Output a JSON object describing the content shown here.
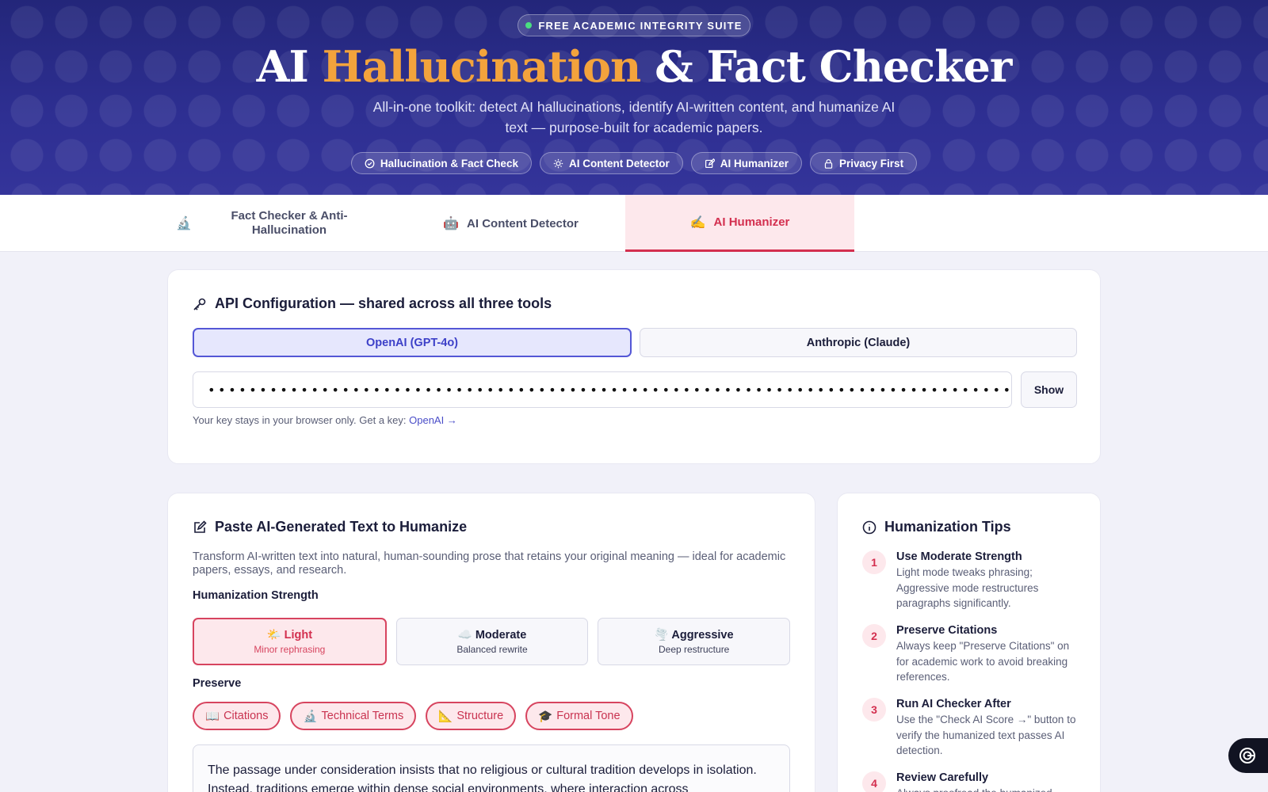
{
  "hero": {
    "badge": "FREE ACADEMIC INTEGRITY SUITE",
    "title_part1": "AI ",
    "title_accent": "Hallucination",
    "title_part2": " & Fact Checker",
    "subtitle": "All-in-one toolkit: detect AI hallucinations, identify AI-written content, and humanize AI text — purpose-built for academic papers.",
    "pills": [
      {
        "label": "Hallucination & Fact Check",
        "icon": "check-circle-icon"
      },
      {
        "label": "AI Content Detector",
        "icon": "bulb-icon"
      },
      {
        "label": "AI Humanizer",
        "icon": "edit-icon"
      },
      {
        "label": "Privacy First",
        "icon": "lock-icon"
      }
    ]
  },
  "tabs": [
    {
      "label": "Fact Checker & Anti-Hallucination",
      "emoji": "🔬"
    },
    {
      "label": "AI Content Detector",
      "emoji": "🤖"
    },
    {
      "label": "AI Humanizer",
      "emoji": "✍️",
      "active": true
    }
  ],
  "api": {
    "title": "API Configuration — shared across all three tools",
    "providers": [
      {
        "label": "OpenAI (GPT-4o)",
        "active": true
      },
      {
        "label": "Anthropic (Claude)",
        "active": false
      }
    ],
    "key_value": "••••••••••••••••••••••••••••••••••••••••••••••••••••••••••••••••••••••••••••••••••••••••••••••••",
    "show_label": "Show",
    "note": "Your key stays in your browser only. Get a key: ",
    "note_link": "OpenAI →"
  },
  "humanize": {
    "title": "Paste AI-Generated Text to Humanize",
    "description": "Transform AI-written text into natural, human-sounding prose that retains your original meaning — ideal for academic papers, essays, and research.",
    "strength_label": "Humanization Strength",
    "strengths": [
      {
        "emoji": "🌤️",
        "name": "Light",
        "desc": "Minor rephrasing",
        "active": true
      },
      {
        "emoji": "☁️",
        "name": "Moderate",
        "desc": "Balanced rewrite",
        "active": false
      },
      {
        "emoji": "🌪️",
        "name": "Aggressive",
        "desc": "Deep restructure",
        "active": false
      }
    ],
    "preserve_label": "Preserve",
    "preserve": [
      {
        "emoji": "📖",
        "label": "Citations"
      },
      {
        "emoji": "🔬",
        "label": "Technical Terms"
      },
      {
        "emoji": "📐",
        "label": "Structure"
      },
      {
        "emoji": "🎓",
        "label": "Formal Tone"
      }
    ],
    "text": "The passage under consideration insists that no religious or cultural tradition develops in isolation. Instead, traditions emerge within dense social environments, where interaction across"
  },
  "tips": {
    "title": "Humanization Tips",
    "items": [
      {
        "num": "1",
        "title": "Use Moderate Strength",
        "body": "Light mode tweaks phrasing; Aggressive mode restructures paragraphs significantly."
      },
      {
        "num": "2",
        "title": "Preserve Citations",
        "body": "Always keep \"Preserve Citations\" on for academic work to avoid breaking references."
      },
      {
        "num": "3",
        "title": "Run AI Checker After",
        "body": "Use the \"Check AI Score →\" button to verify the humanized text passes AI detection."
      },
      {
        "num": "4",
        "title": "Review Carefully",
        "body": "Always proofread the humanized"
      }
    ]
  },
  "colors": {
    "hero_bg": "#2e2f92",
    "accent_orange": "#f3a33c",
    "active_red": "#d32f4f",
    "primary_indigo": "#5457d6"
  }
}
